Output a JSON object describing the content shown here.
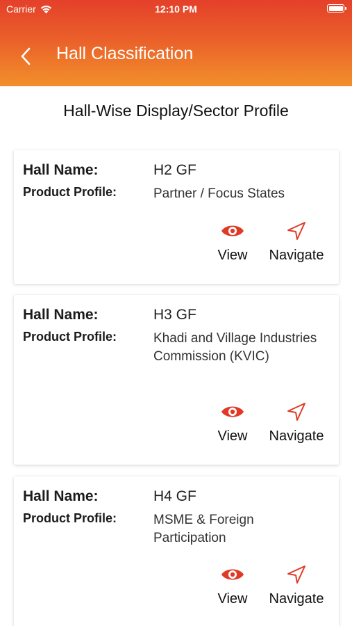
{
  "status_bar": {
    "carrier": "Carrier",
    "time": "12:10 PM"
  },
  "header": {
    "title": "Hall Classification"
  },
  "section_title": "Hall-Wise Display/Sector Profile",
  "labels": {
    "hall_name": "Hall Name:",
    "product_profile": "Product Profile:"
  },
  "actions": {
    "view": "View",
    "navigate": "Navigate"
  },
  "halls": [
    {
      "hall_name": "H2 GF",
      "product_profile": "Partner / Focus States"
    },
    {
      "hall_name": "H3 GF",
      "product_profile": "Khadi and Village Industries Commission (KVIC)"
    },
    {
      "hall_name": "H4 GF",
      "product_profile": "MSME & Foreign Participation"
    }
  ],
  "colors": {
    "header_top": "#e4402a",
    "header_bottom": "#f2902b",
    "icon_red": "#e03a26"
  },
  "icons": {
    "back": "chevron-left-icon",
    "view": "eye-icon",
    "navigate": "navigation-arrow-icon"
  }
}
